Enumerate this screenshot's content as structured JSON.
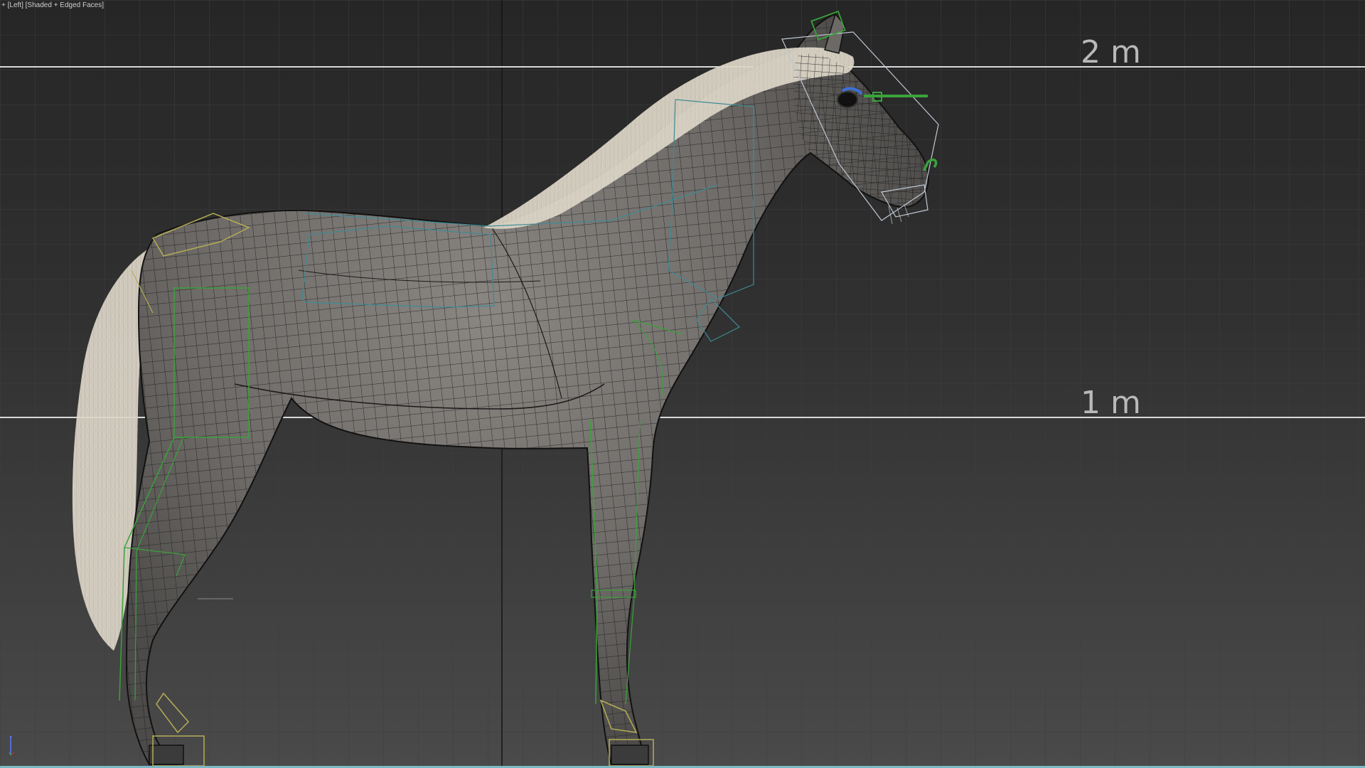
{
  "viewport": {
    "plus_menu": "+",
    "view_name": "[Left]",
    "shading_mode": "[Shaded + Edged Faces]"
  },
  "reference_lines": {
    "upper_label": "2 m",
    "lower_label": "1 m"
  },
  "colors": {
    "grid_minor": "#3c3c3c",
    "grid_major": "#4a4a4a",
    "reference_line": "#d8d8d8",
    "mesh_fill": "#707070",
    "mesh_wire": "#1a1a1a",
    "bone_green": "#3aa23a",
    "bone_yellow": "#b5ad55",
    "bone_cyan": "#3f8b95",
    "hair": "#ddd6c8",
    "viewport_border": "#7ab8c4"
  },
  "icons": {
    "axis_gizmo": "axis-tripod-icon"
  }
}
